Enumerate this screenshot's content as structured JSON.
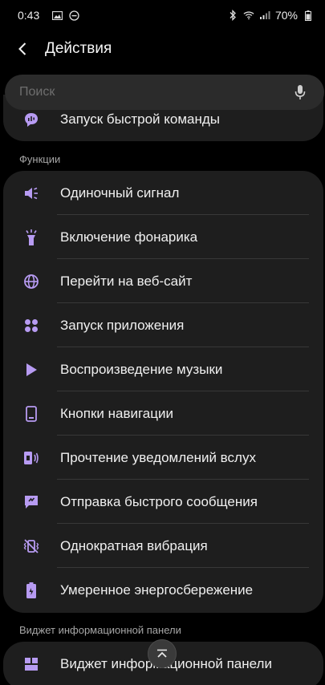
{
  "status": {
    "time": "0:43",
    "battery": "70%"
  },
  "appbar": {
    "title": "Действия"
  },
  "search": {
    "placeholder": "Поиск"
  },
  "top_item": {
    "label": "Запуск быстрой команды",
    "icon": "chat-bubble-icon"
  },
  "sections": {
    "functions": "Функции",
    "widget": "Виджет информационной панели"
  },
  "functions": [
    {
      "label": "Одиночный сигнал",
      "icon": "speaker-icon"
    },
    {
      "label": "Включение фонарика",
      "icon": "flashlight-icon"
    },
    {
      "label": "Перейти на веб-сайт",
      "icon": "globe-icon"
    },
    {
      "label": "Запуск приложения",
      "icon": "apps-grid-icon"
    },
    {
      "label": "Воспроизведение музыки",
      "icon": "play-icon"
    },
    {
      "label": "Кнопки навигации",
      "icon": "phone-nav-icon"
    },
    {
      "label": "Прочтение уведомлений вслух",
      "icon": "read-aloud-icon"
    },
    {
      "label": "Отправка быстрого сообщения",
      "icon": "quick-message-icon"
    },
    {
      "label": "Однократная вибрация",
      "icon": "vibrate-icon"
    },
    {
      "label": "Умеренное энергосбережение",
      "icon": "battery-saver-icon"
    }
  ],
  "widget_item": {
    "label": "Виджет информационной панели",
    "icon": "widget-icon"
  },
  "colors": {
    "accent": "#b79bf2",
    "background": "#000000",
    "card": "#1e1e1e"
  }
}
